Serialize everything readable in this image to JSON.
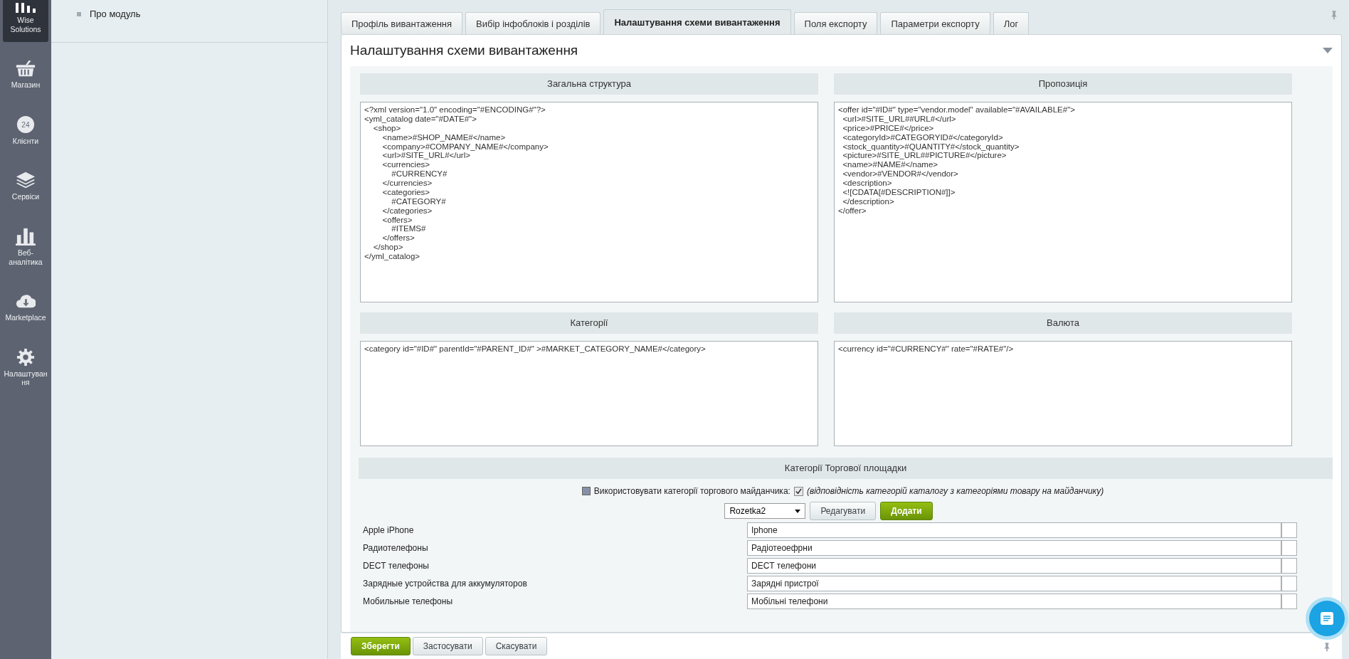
{
  "sidebar": {
    "items": [
      {
        "label": "Wise Solutions",
        "selected": true
      },
      {
        "label": "Магазин",
        "selected": false
      },
      {
        "label": "Клієнти",
        "icon_text": "24",
        "selected": false
      },
      {
        "label": "Сервіси",
        "selected": false
      },
      {
        "label": "Веб-аналітика",
        "selected": false
      },
      {
        "label": "Marketplace",
        "selected": false
      },
      {
        "label": "Налаштування",
        "selected": false
      }
    ]
  },
  "left_menu": {
    "items": [
      {
        "label": "Про модуль"
      }
    ]
  },
  "tabs": [
    {
      "label": "Профіль вивантаження",
      "selected": false
    },
    {
      "label": "Вибір інфоблоків і розділів",
      "selected": false
    },
    {
      "label": "Налаштування схеми вивантаження",
      "selected": true
    },
    {
      "label": "Поля експорту",
      "selected": false
    },
    {
      "label": "Параметри експорту",
      "selected": false
    },
    {
      "label": "Лог",
      "selected": false
    }
  ],
  "panel": {
    "title": "Налаштування схеми вивантаження",
    "sections": [
      {
        "title": "Загальна структура",
        "value": "<?xml version=\"1.0\" encoding=\"#ENCODING#\"?>\n<yml_catalog date=\"#DATE#\">\n\t<shop>\n\t\t<name>#SHOP_NAME#</name>\n\t\t<company>#COMPANY_NAME#</company>\n\t\t<url>#SITE_URL#</url>\n\t\t<currencies>\n\t\t\t#CURRENCY#\n\t\t</currencies>\n\t\t<categories>\n\t\t\t#CATEGORY#\n\t\t</categories>\n\t\t<offers>\n\t\t\t#ITEMS#\n\t\t</offers>\n\t</shop>\n</yml_catalog>"
      },
      {
        "title": "Пропозиція",
        "value": "<offer id=\"#ID#\" type=\"vendor.model\" available=\"#AVAILABLE#\">\n  <url>#SITE_URL##URL#</url>\n  <price>#PRICE#</price>\n  <categoryId>#CATEGORYID#</categoryId>\n  <stock_quantity>#QUANTITY#</stock_quantity>\n  <picture>#SITE_URL##PICTURE#</picture>\n  <name>#NAME#</name>\n  <vendor>#VENDOR#</vendor>\n  <description>\n  <![CDATA[#DESCRIPTION#]]>\n  </description>\n</offer>"
      },
      {
        "title": "Категорії",
        "value": "<category id=\"#ID#\" parentId=\"#PARENT_ID#\" >#MARKET_CATEGORY_NAME#</category>"
      },
      {
        "title": "Валюта",
        "value": "<currency id=\"#CURRENCY#\" rate=\"#RATE#\"/>"
      }
    ],
    "marketplace": {
      "title": "Категорії Торгової площадки",
      "use_label": "Використовувати категорії торгового майданчика:",
      "use_checked": true,
      "use_hint": "(відповідність категорій каталогу з категоріями товару на майданчику)",
      "select_value": "Rozetka2",
      "edit_button": "Редагувати",
      "add_button": "Додати",
      "rows": [
        {
          "name": "Apple iPhone",
          "value": "Iphone"
        },
        {
          "name": "Радиотелефоны",
          "value": "Радіотеоефрни"
        },
        {
          "name": "DECT телефоны",
          "value": "DECT телефони"
        },
        {
          "name": "Зарядные устройства для аккумуляторов",
          "value": "Зарядні пристрої"
        },
        {
          "name": "Мобильные телефоны",
          "value": "Мобільні телефони"
        }
      ]
    }
  },
  "footer": {
    "buttons": [
      {
        "label": "Зберегти",
        "kind": "primary"
      },
      {
        "label": "Застосувати",
        "kind": "plain"
      },
      {
        "label": "Скасувати",
        "kind": "plain"
      }
    ]
  }
}
